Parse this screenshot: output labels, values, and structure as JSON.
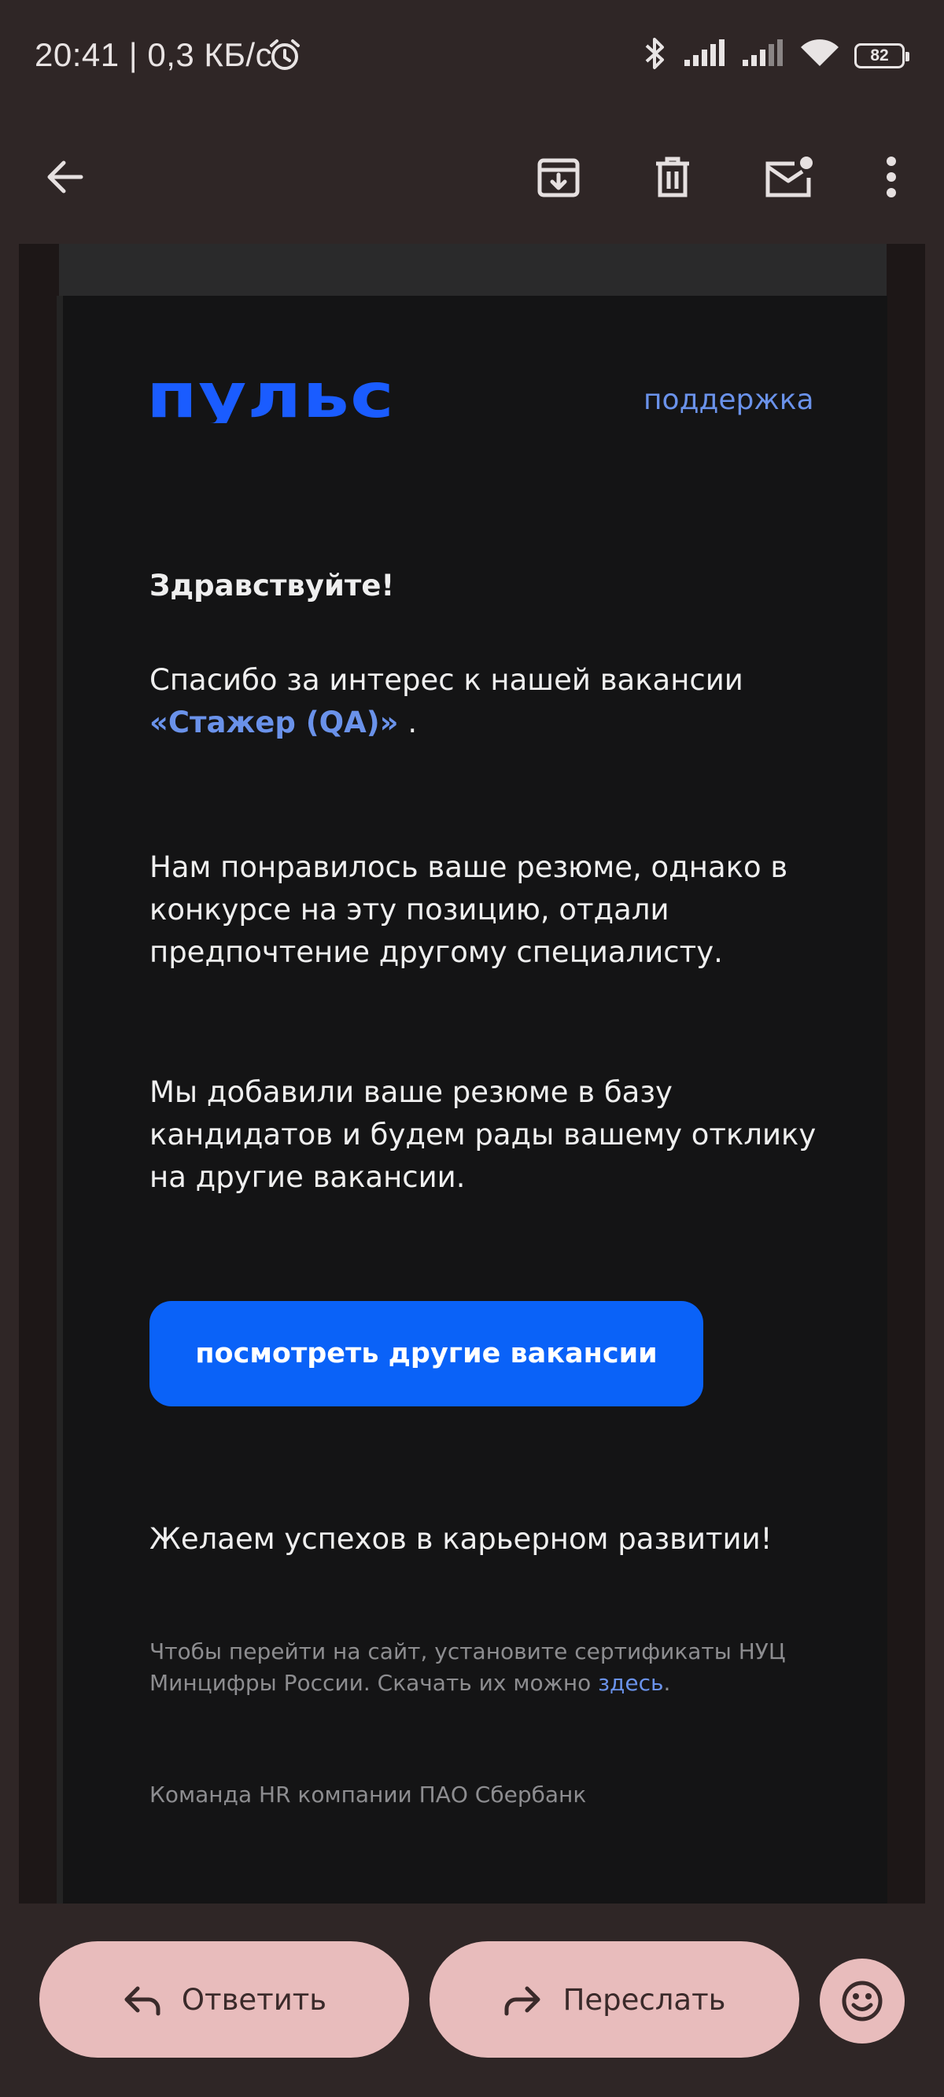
{
  "status_bar": {
    "time": "20:41 | 0,3 КБ/с",
    "battery": "82"
  },
  "email": {
    "brand": "пульс",
    "support_link": "поддержка",
    "greeting": "Здравствуйте!",
    "para1": "Спасибо за интерес к нашей вакансии",
    "vacancy": "«Стажер (QA)»",
    "para1_end": " .",
    "para2": "Нам понравилось ваше резюме, однако в конкурсе на эту позицию, отдали предпочтение другому специалисту.",
    "para3": "Мы добавили ваше резюме в базу кандидатов и будем рады вашему отклику на другие вакансии.",
    "cta_button": "посмотреть другие вакансии",
    "para4": "Желаем успехов в карьерном развитии!",
    "note": "Чтобы перейти на сайт, установите сертификаты НУЦ Минцифры России. Скачать их можно",
    "note_link": "здесь",
    "note_end": ".",
    "signature": "Команда HR компании ПАО Сбербанк"
  },
  "actions": {
    "reply": "Ответить",
    "forward": "Переслать"
  }
}
